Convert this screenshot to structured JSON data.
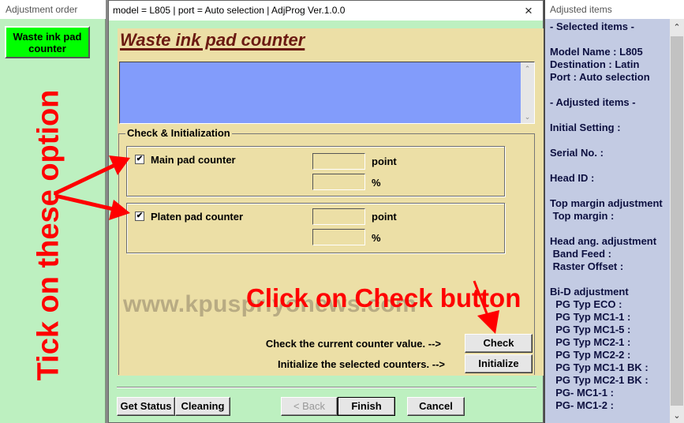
{
  "left_window": {
    "title": "Adjustment order",
    "items": [
      {
        "label": "Waste ink pad\ncounter",
        "line1": "Waste ink pad",
        "line2": "counter",
        "color": "#00ff00"
      }
    ]
  },
  "dialog": {
    "title": "model = L805 | port = Auto selection | AdjProg Ver.1.0.0",
    "close_icon": "×",
    "heading": "Waste ink pad counter",
    "log_text": "",
    "scroll_up": "⌃",
    "scroll_down": "⌄",
    "group_label": "Check & Initialization",
    "counters": [
      {
        "label": "Main pad counter",
        "checked": true,
        "check_glyph": "✔",
        "point_value": "",
        "percent_value": "",
        "point_unit": "point",
        "percent_unit": "%"
      },
      {
        "label": "Platen pad counter",
        "checked": true,
        "check_glyph": "✔",
        "point_value": "",
        "percent_value": "",
        "point_unit": "point",
        "percent_unit": "%"
      }
    ],
    "check_hint": "Check the current counter value. -->",
    "init_hint": "Initialize the selected counters. -->",
    "check_button": "Check",
    "initialize_button": "Initialize",
    "footer_buttons": {
      "get_status": "Get Status",
      "cleaning": "Cleaning",
      "back": "< Back",
      "finish": "Finish",
      "cancel": "Cancel"
    },
    "watermark": "www.kpuspriyonews.com"
  },
  "annotations": {
    "tick_text": "Tick on these option",
    "check_text": "Click on Check button",
    "color": "#ff0000"
  },
  "right_window": {
    "title": "Adjusted items",
    "lines": [
      "- Selected items -",
      "",
      "Model Name : L805",
      "Destination : Latin",
      "Port : Auto selection",
      "",
      "- Adjusted items -",
      "",
      "Initial Setting :",
      "",
      "Serial No. :",
      "",
      "Head ID :",
      "",
      "Top margin adjustment",
      " Top margin :",
      "",
      "Head ang. adjustment",
      " Band Feed :",
      " Raster Offset :",
      "",
      "Bi-D adjustment",
      "  PG Typ ECO :",
      "  PG Typ MC1-1 :",
      "  PG Typ MC1-5 :",
      "  PG Typ MC2-1 :",
      "  PG Typ MC2-2 :",
      "  PG Typ MC1-1 BK :",
      "  PG Typ MC2-1 BK :",
      "  PG- MC1-1 :",
      "  PG- MC1-2 :"
    ],
    "scroll_up": "⌃",
    "scroll_down": "⌄"
  }
}
